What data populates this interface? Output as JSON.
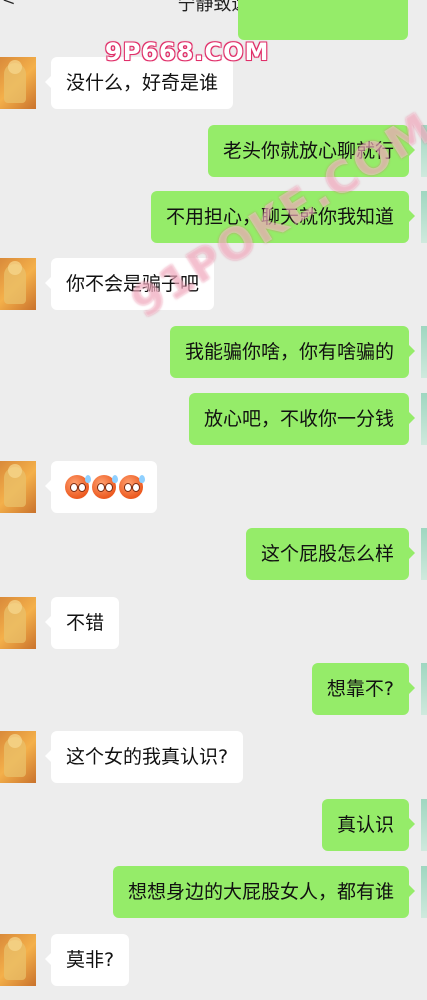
{
  "header": {
    "title": "宁静致远",
    "back_glyph": "<"
  },
  "watermarks": {
    "primary": "9P668.COM",
    "secondary": "91POKE.COM"
  },
  "messages": [
    {
      "side": "left",
      "text": "没什么，好奇是谁"
    },
    {
      "side": "right",
      "text": "老头你就放心聊就行"
    },
    {
      "side": "right",
      "text": "不用担心，聊天就你我知道"
    },
    {
      "side": "left",
      "text": "你不会是骗子吧"
    },
    {
      "side": "right",
      "text": "我能骗你啥，你有啥骗的"
    },
    {
      "side": "right",
      "text": "放心吧，不收你一分钱"
    },
    {
      "side": "left",
      "emoji": [
        "flushed-face-emoji",
        "flushed-face-emoji",
        "flushed-face-emoji"
      ]
    },
    {
      "side": "right",
      "text": "这个屁股怎么样"
    },
    {
      "side": "left",
      "text": "不错"
    },
    {
      "side": "right",
      "text": "想靠不?"
    },
    {
      "side": "left",
      "text": "这个女的我真认识?"
    },
    {
      "side": "right",
      "text": "真认识"
    },
    {
      "side": "right",
      "text": "想想身边的大屁股女人，都有谁"
    },
    {
      "side": "left",
      "text": "莫非?"
    }
  ],
  "colors": {
    "background": "#ededed",
    "sent_bubble": "#95ec69",
    "received_bubble": "#ffffff"
  }
}
